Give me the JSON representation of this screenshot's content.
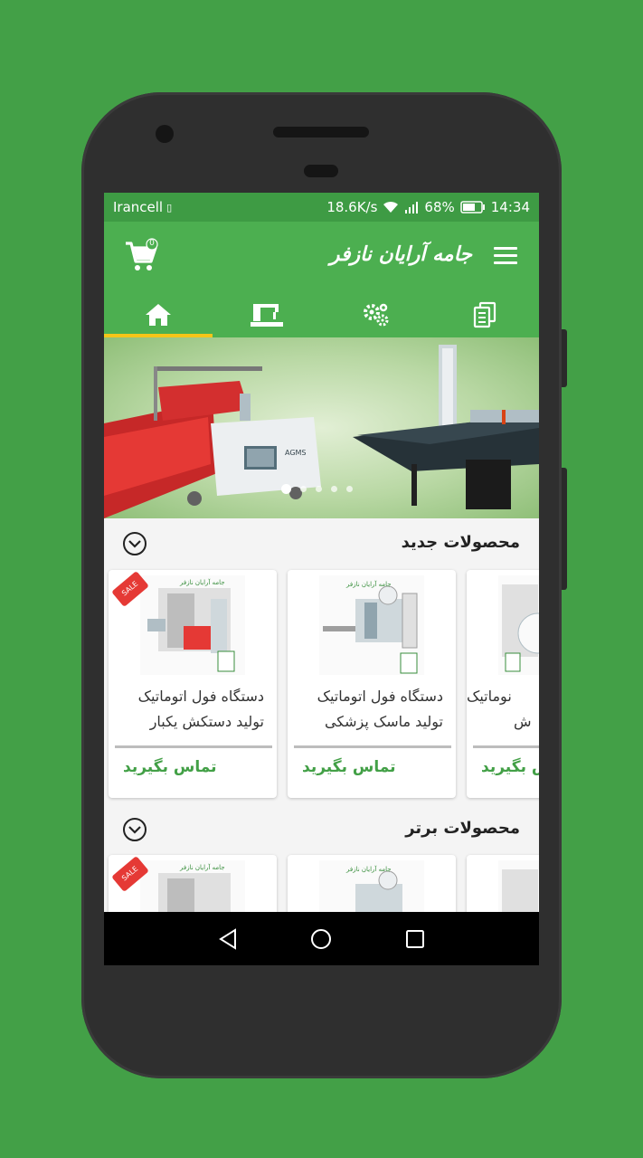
{
  "status_bar": {
    "carrier": "Irancell",
    "speed": "18.6K/s",
    "battery": "68%",
    "time": "14:34"
  },
  "app_bar": {
    "title": "جامه آرایان نازفر",
    "cart_count": "0"
  },
  "tabs": [
    {
      "icon": "home-icon",
      "active": true
    },
    {
      "icon": "sewing-machine-icon",
      "active": false
    },
    {
      "icon": "gears-icon",
      "active": false
    },
    {
      "icon": "documents-icon",
      "active": false
    }
  ],
  "banner": {
    "slide_count": 5,
    "active_slide": 1
  },
  "sections": {
    "new_products": {
      "title": "محصولات جدید",
      "items": [
        {
          "title_line1": "دستگاه فول اتوماتیک",
          "title_line2": "تولید دستکش یکبار",
          "action": "تماس بگیرید",
          "sale": true,
          "sale_label": "SALE"
        },
        {
          "title_line1": "دستگاه فول اتوماتیک",
          "title_line2": "تولید ماسک پزشکی",
          "action": "تماس بگیرید",
          "sale": false
        },
        {
          "title_line1": "نوماتیک",
          "title_line2": "ش",
          "action": "تماس بگیرید",
          "sale": false
        }
      ]
    },
    "top_products": {
      "title": "محصولات برتر",
      "items": [
        {
          "sale": true,
          "sale_label": "SALE"
        },
        {
          "sale": false
        },
        {
          "sale": false
        }
      ]
    }
  },
  "colors": {
    "primary": "#4caf50",
    "status_bar": "#3e9b44",
    "accent": "#f5c518",
    "action_text": "#43a047",
    "background": "#43a047"
  }
}
